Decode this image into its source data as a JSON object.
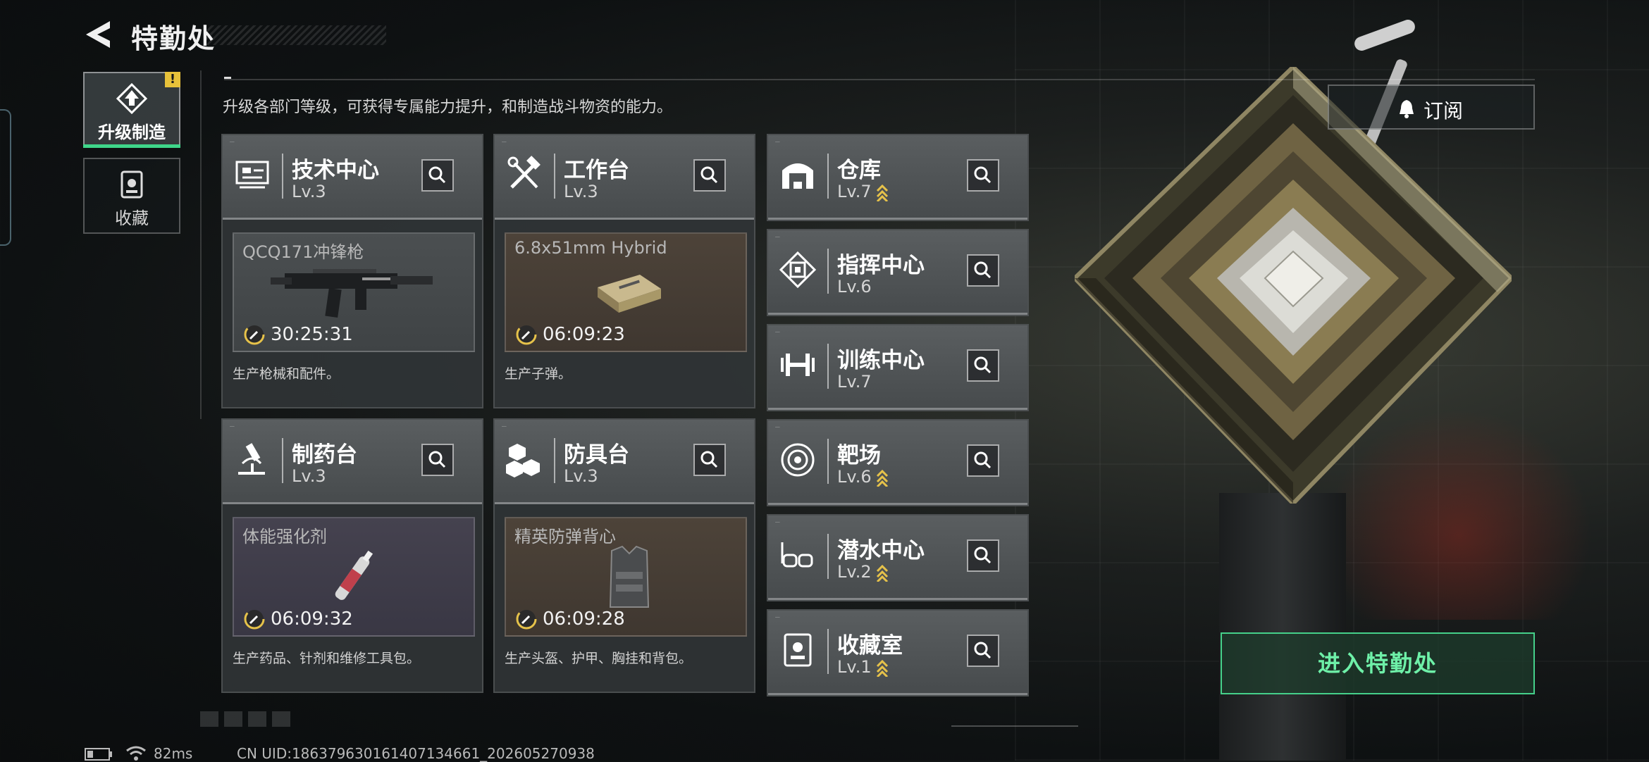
{
  "header": {
    "title": "特勤处"
  },
  "sidebar": {
    "tabs": [
      {
        "label": "升级制造",
        "badge": "!"
      },
      {
        "label": "收藏"
      }
    ]
  },
  "intro": "升级各部门等级，可获得专属能力提升，和制造战斗物资的能力。",
  "subscribe": {
    "label": "订阅"
  },
  "enter_button": {
    "label": "进入特勤处"
  },
  "production_departments": [
    {
      "name": "技术中心",
      "level": "Lv.3",
      "product": "QCQ171冲锋枪",
      "timer": "30:25:31",
      "desc": "生产枪械和配件。"
    },
    {
      "name": "工作台",
      "level": "Lv.3",
      "product": "6.8x51mm Hybrid",
      "timer": "06:09:23",
      "desc": "生产子弹。"
    },
    {
      "name": "制药台",
      "level": "Lv.3",
      "product": "体能强化剂",
      "timer": "06:09:32",
      "desc": "生产药品、针剂和维修工具包。"
    },
    {
      "name": "防具台",
      "level": "Lv.3",
      "product": "精英防弹背心",
      "timer": "06:09:28",
      "desc": "生产头盔、护甲、胸挂和背包。"
    }
  ],
  "departments": [
    {
      "name": "仓库",
      "level": "Lv.7",
      "upgradable": true
    },
    {
      "name": "指挥中心",
      "level": "Lv.6",
      "upgradable": false
    },
    {
      "name": "训练中心",
      "level": "Lv.7",
      "upgradable": false
    },
    {
      "name": "靶场",
      "level": "Lv.6",
      "upgradable": true
    },
    {
      "name": "潜水中心",
      "level": "Lv.2",
      "upgradable": true
    },
    {
      "name": "收藏室",
      "level": "Lv.1",
      "upgradable": true
    }
  ],
  "status_bar": {
    "ping": "82ms",
    "uid": "CN UID:18637963016140713466​1_202605270938"
  },
  "colors": {
    "accent": "#45d08a",
    "upgrade_arrow": "#e6c24a",
    "badge": "#e8c23a"
  },
  "icons": {
    "tech_center": "circuit-board-icon",
    "workbench": "hammer-wrench-icon",
    "pharmacy": "microscope-icon",
    "armor": "cubes-icon",
    "warehouse": "garage-icon",
    "command": "chip-icon",
    "training": "dumbbell-icon",
    "range": "target-icon",
    "diving": "diving-mask-icon",
    "collection": "trophy-case-icon"
  }
}
